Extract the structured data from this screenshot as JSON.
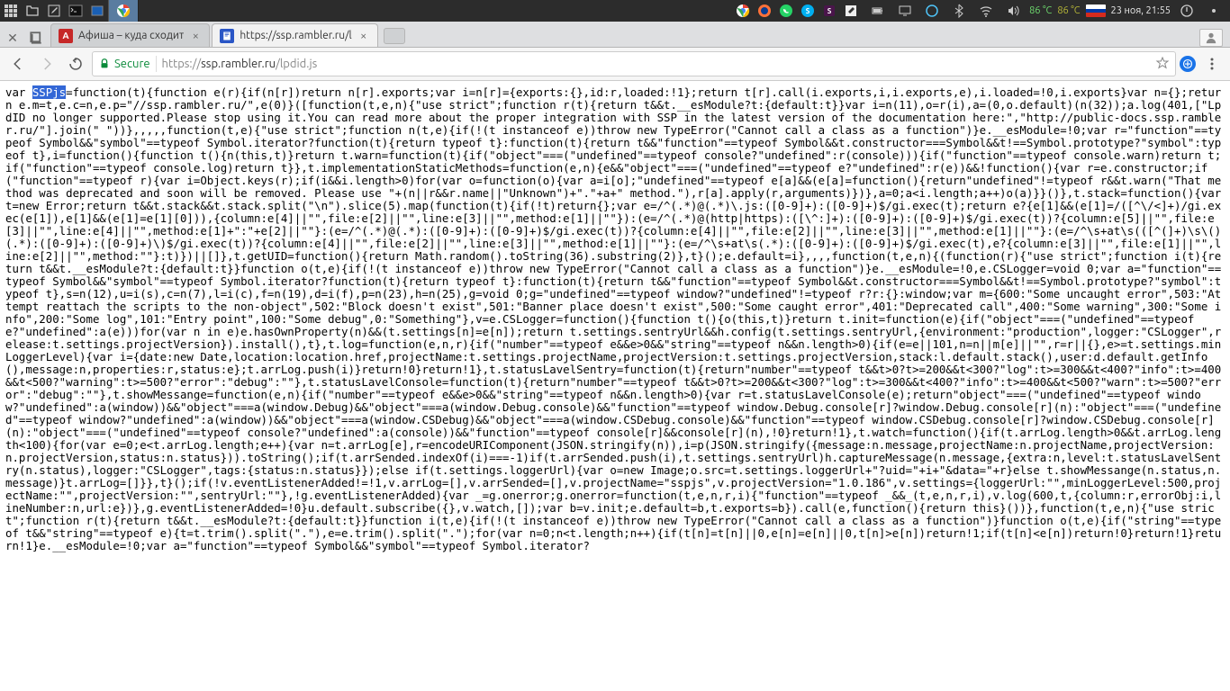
{
  "taskbar": {
    "datetime": "23 ноя, 21:55",
    "temp1": "86 °C",
    "temp2": "86 °C"
  },
  "tabs": [
    {
      "title": "Афиша – куда сходит",
      "favicon_bg": "#c62828",
      "favicon_text": "А",
      "active": false
    },
    {
      "title": "https://ssp.rambler.ru/l",
      "favicon_bg": "#2a56c6",
      "favicon_text": "",
      "active": true
    }
  ],
  "address": {
    "secure_label": "Secure",
    "protocol": "https://",
    "host": "ssp.rambler.ru",
    "path": "/lpdid.js"
  },
  "code": {
    "prefix": "var ",
    "highlight": "SSPjs",
    "body": "=function(t){function e(r){if(n[r])return n[r].exports;var i=n[r]={exports:{},id:r,loaded:!1};return t[r].call(i.exports,i,i.exports,e),i.loaded=!0,i.exports}var n={};return e.m=t,e.c=n,e.p=\"//ssp.rambler.ru/\",e(0)}([function(t,e,n){\"use strict\";function r(t){return t&&t.__esModule?t:{default:t}}var i=n(11),o=r(i),a=(0,o.default)(n(32));a.log(401,[\"LpdID no longer supported.Please stop using it.You can read more about the proper integration with SSP in the latest version of the documentation here:\",\"http://public-docs.ssp.rambler.ru/\"].join(\" \"))},,,,,function(t,e){\"use strict\";function n(t,e){if(!(t instanceof e))throw new TypeError(\"Cannot call a class as a function\")}e.__esModule=!0;var r=\"function\"==typeof Symbol&&\"symbol\"==typeof Symbol.iterator?function(t){return typeof t}:function(t){return t&&\"function\"==typeof Symbol&&t.constructor===Symbol&&t!==Symbol.prototype?\"symbol\":typeof t},i=function(){function t(){n(this,t)}return t.warn=function(t){if(\"object\"===(\"undefined\"==typeof console?\"undefined\":r(console))){if(\"function\"==typeof console.warn)return t;if(\"function\"==typeof console.log)return t}},t.implementationStaticMethods=function(e,n){e&&\"object\"===(\"undefined\"==typeof e?\"undefined\":r(e))&&!function(){var r=e.constructor;if(\"function\"==typeof r){var i=Object.keys(r);if(i&&i.length>0)for(var o=function(o){var a=i[o];\"undefined\"==typeof e[a]&&(e[a]=function(){return\"undefined\"!=typeof r&&t.warn(\"That method was deprecated and soon will be removed. Please use \"+(n||r&&r.name||\"Unknown\")+\".\"+a+\" method.\"),r[a].apply(r,arguments)})},a=0;a<i.length;a++)o(a)}}()},t.stack=function(){var t=new Error;return t&&t.stack&&t.stack.split(\"\\n\").slice(5).map(function(t){if(!t)return{};var e=/^(.*)@(.*)\\.js:([0-9]+):([0-9]+)$/gi.exec(t);return e?{e[1]&&(e[1]=/([^\\/<]+)/gi.exec(e[1]),e[1]&&(e[1]=e[1][0])),{column:e[4]||\"\",file:e[2]||\"\",line:e[3]||\"\",method:e[1]||\"\"}):(e=/^(.*)@(http|https):([\\^:]+):([0-9]+):([0-9]+)$/gi.exec(t))?{column:e[5]||\"\",file:e[3]||\"\",line:e[4]||\"\",method:e[1]+\":\"+e[2]||\"\"}:(e=/^(.*)@(.*):([0-9]+):([0-9]+)$/gi.exec(t))?{column:e[4]||\"\",file:e[2]||\"\",line:e[3]||\"\",method:e[1]||\"\"}:(e=/^\\s+at\\s(([^(]+)\\s\\()(.*):([0-9]+):([0-9]+)\\)$/gi.exec(t))?{column:e[4]||\"\",file:e[2]||\"\",line:e[3]||\"\",method:e[1]||\"\"}:(e=/^\\s+at\\s(.*):([0-9]+):([0-9]+)$/gi.exec(t),e?{column:e[3]||\"\",file:e[1]||\"\",line:e[2]||\"\",method:\"\"}:t)})||[]},t.getUID=function(){return Math.random().toString(36).substring(2)},t}();e.default=i},,,,function(t,e,n){(function(r){\"use strict\";function i(t){return t&&t.__esModule?t:{default:t}}function o(t,e){if(!(t instanceof e))throw new TypeError(\"Cannot call a class as a function\")}e.__esModule=!0,e.CSLogger=void 0;var a=\"function\"==typeof Symbol&&\"symbol\"==typeof Symbol.iterator?function(t){return typeof t}:function(t){return t&&\"function\"==typeof Symbol&&t.constructor===Symbol&&t!==Symbol.prototype?\"symbol\":typeof t},s=n(12),u=i(s),c=n(7),l=i(c),f=n(19),d=i(f),p=n(23),h=n(25),g=void 0;g=\"undefined\"==typeof window?\"undefined\"!=typeof r?r:{}:window;var m={600:\"Some uncaught error\",503:\"Attempt reattach the scripts to the non-object\",502:\"Block doesn't exist\",501:\"Banner place doesn't exist\",500:\"Some caught error\",401:\"Deprecated call\",400:\"Some warning\",300:\"Some info\",200:\"Some log\",101:\"Entry point\",100:\"Some debug\",0:\"Something\"},v=e.CSLogger=function(){function t(){o(this,t)}return t.init=function(e){if(\"object\"===(\"undefined\"==typeof e?\"undefined\":a(e)))for(var n in e)e.hasOwnProperty(n)&&(t.settings[n]=e[n]);return t.settings.sentryUrl&&h.config(t.settings.sentryUrl,{environment:\"production\",logger:\"CSLogger\",release:t.settings.projectVersion}).install(),t},t.log=function(e,n,r){if(\"number\"==typeof e&&e>0&&\"string\"==typeof n&&n.length>0){if(e=e||101,n=n||m[e]||\"\",r=r||{},e>=t.settings.minLoggerLevel){var i={date:new Date,location:location.href,projectName:t.settings.projectName,projectVersion:t.settings.projectVersion,stack:l.default.stack(),user:d.default.getInfo(),message:n,properties:r,status:e};t.arrLog.push(i)}return!0}return!1},t.statusLavelSentry=function(t){return\"number\"==typeof t&&t>0?t>=200&&t<300?\"log\":t>=300&&t<400?\"info\":t>=400&&t<500?\"warning\":t>=500?\"error\":\"debug\":\"\"},t.statusLavelConsole=function(t){return\"number\"==typeof t&&t>0?t>=200&&t<300?\"log\":t>=300&&t<400?\"info\":t>=400&&t<500?\"warn\":t>=500?\"error\":\"debug\":\"\"},t.showMessange=function(e,n){if(\"number\"==typeof e&&e>0&&\"string\"==typeof n&&n.length>0){var r=t.statusLavelConsole(e);return\"object\"===(\"undefined\"==typeof window?\"undefined\":a(window))&&\"object\"===a(window.Debug)&&\"object\"===a(window.Debug.console)&&\"function\"==typeof window.Debug.console[r]?window.Debug.console[r](n):\"object\"===(\"undefined\"==typeof window?\"undefined\":a(window))&&\"object\"===a(window.CSDebug)&&\"object\"===a(window.CSDebug.console)&&\"function\"==typeof window.CSDebug.console[r]?window.CSDebug.console[r](n):\"object\"===(\"undefined\"==typeof console?\"undefined\":a(console))&&\"function\"==typeof console[r]&&console[r](n),!0}return!1},t.watch=function(){if(t.arrLog.length>0&&t.arrLog.length<100){for(var e=0;e<t.arrLog.length;e++){var n=t.arrLog[e],r=encodeURIComponent(JSON.stringify(n)),i=p(JSON.stringify({message:n.message,projectName:n.projectName,projectVersion:n.projectVersion,status:n.status})).toString();if(t.arrSended.indexOf(i)===-1)if(t.arrSended.push(i),t.settings.sentryUrl)h.captureMessage(n.message,{extra:n,level:t.statusLavelSentry(n.status),logger:\"CSLogger\",tags:{status:n.status}});else if(t.settings.loggerUrl){var o=new Image;o.src=t.settings.loggerUrl+\"?uid=\"+i+\"&data=\"+r}else t.showMessange(n.status,n.message)}t.arrLog=[]}},t}();if(!v.eventListenerAdded!=!1,v.arrLog=[],v.arrSended=[],v.projectName=\"sspjs\",v.projectVersion=\"1.0.186\",v.settings={loggerUrl:\"\",minLoggerLevel:500,projectName:\"\",projectVersion:\"\",sentryUrl:\"\"},!g.eventListenerAdded){var _=g.onerror;g.onerror=function(t,e,n,r,i){\"function\"==typeof _&&_(t,e,n,r,i),v.log(600,t,{column:r,errorObj:i,lineNumber:n,url:e})},g.eventListenerAdded=!0}u.default.subscribe({},v.watch,[]);var b=v.init;e.default=b,t.exports=b}).call(e,function(){return this}())},function(t,e,n){\"use strict\";function r(t){return t&&t.__esModule?t:{default:t}}function i(t,e){if(!(t instanceof e))throw new TypeError(\"Cannot call a class as a function\")}function o(t,e){if(\"string\"==typeof t&&\"string\"==typeof e){t=t.trim().split(\".\"),e=e.trim().split(\".\");for(var n=0;n<t.length;n++){if(t[n]=t[n]||0,e[n]=e[n]||0,t[n]>e[n])return!1;if(t[n]<e[n])return!0}return!1}return!1}e.__esModule=!0;var a=\"function\"==typeof Symbol&&\"symbol\"==typeof Symbol.iterator?"
  }
}
